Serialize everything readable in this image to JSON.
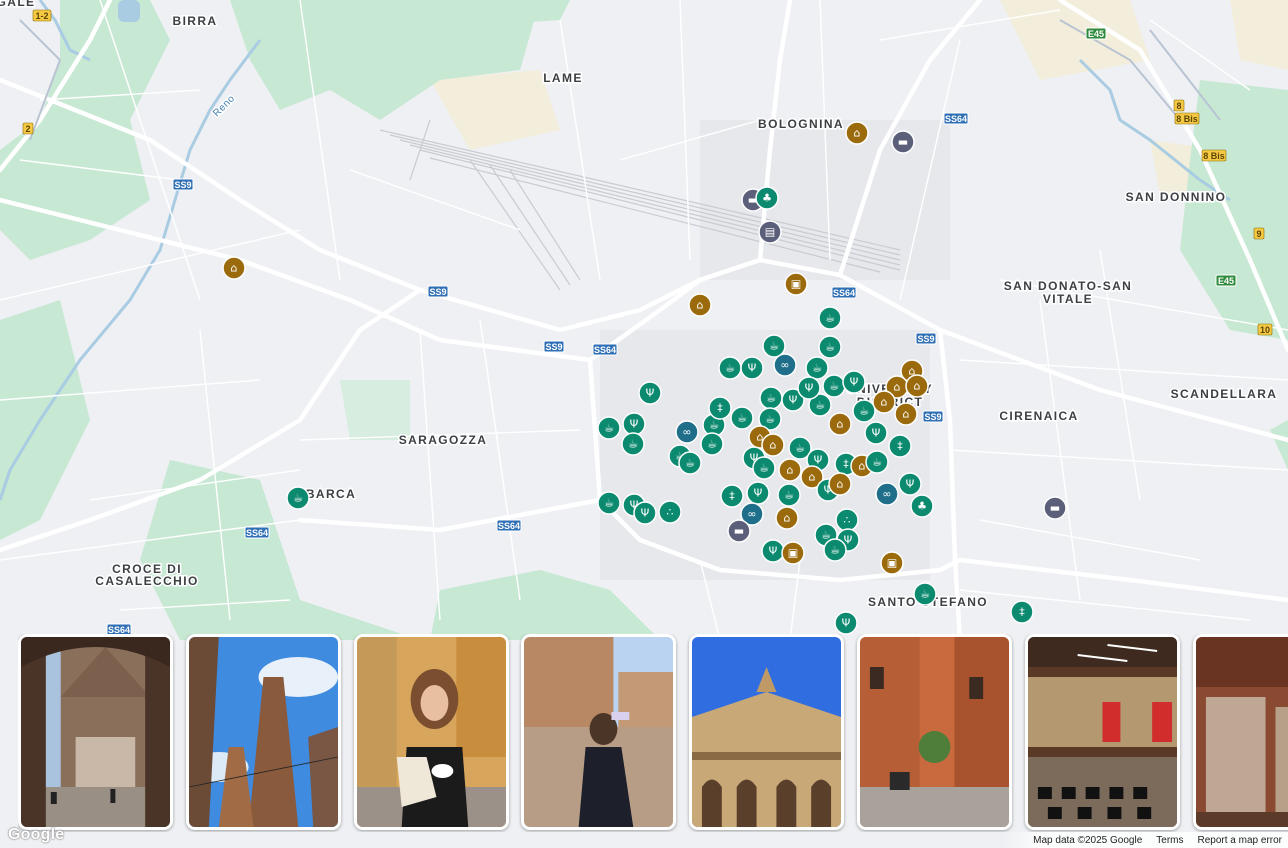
{
  "map": {
    "places": [
      {
        "id": "birra",
        "label": "BIRRA"
      },
      {
        "id": "lame",
        "label": "LAME"
      },
      {
        "id": "bolognina",
        "label": "BOLOGNINA"
      },
      {
        "id": "san-donnino",
        "label": "SAN DONNINO"
      },
      {
        "id": "san-donato-1",
        "label": "SAN DONATO-SAN"
      },
      {
        "id": "san-donato-2",
        "label": "VITALE"
      },
      {
        "id": "scandellara",
        "label": "SCANDELLARA"
      },
      {
        "id": "cirenaica",
        "label": "CIRENAICA"
      },
      {
        "id": "university-1",
        "label": "UNIVERSITY"
      },
      {
        "id": "university-2",
        "label": "DISTRICT"
      },
      {
        "id": "saragozza",
        "label": "SARAGOZZA"
      },
      {
        "id": "barca",
        "label": "BARCA"
      },
      {
        "id": "croce-1",
        "label": "CROCE DI"
      },
      {
        "id": "croce-2",
        "label": "CASALECCHIO"
      },
      {
        "id": "santo-stefano",
        "label": "SANTO STEFANO"
      },
      {
        "id": "gale",
        "label": "GALE"
      },
      {
        "id": "reno",
        "label": "Reno"
      }
    ],
    "road_shields": [
      {
        "label": "SS9"
      },
      {
        "label": "SS9"
      },
      {
        "label": "SS9"
      },
      {
        "label": "SS9"
      },
      {
        "label": "SS9"
      },
      {
        "label": "SS64"
      },
      {
        "label": "SS64"
      },
      {
        "label": "SS64"
      },
      {
        "label": "SS64"
      },
      {
        "label": "SS64"
      },
      {
        "label": "SS64"
      },
      {
        "label": "E45"
      },
      {
        "label": "E45"
      },
      {
        "label": "1-2"
      },
      {
        "label": "2"
      },
      {
        "label": "8"
      },
      {
        "label": "8 Bis"
      },
      {
        "label": "8 Bis"
      },
      {
        "label": "9"
      },
      {
        "label": "10"
      }
    ],
    "poi_categories": {
      "museum": {
        "color": "#9a6a0c",
        "icon": "museum-icon"
      },
      "hotel": {
        "color": "#5c5f7a",
        "icon": "bed-icon"
      },
      "restaurant": {
        "color": "#0c8a6f",
        "icon": "fork-knife-icon"
      },
      "cafe": {
        "color": "#0c8a6f",
        "icon": "coffee-cup-icon"
      },
      "bar": {
        "color": "#0c8a6f",
        "icon": "wine-bottle-icon"
      },
      "shopping": {
        "color": "#9a6a0c",
        "icon": "shopping-bag-icon"
      },
      "sight": {
        "color": "#1f6f8b",
        "icon": "binoculars-icon"
      },
      "park": {
        "color": "#0c8a6f",
        "icon": "tree-icon"
      },
      "transit": {
        "color": "#5c5f7a",
        "icon": "train-icon"
      },
      "grapes": {
        "color": "#0c8a6f",
        "icon": "grapes-icon"
      }
    }
  },
  "photos": [
    {
      "name": "photo-basilica-arches"
    },
    {
      "name": "photo-two-towers"
    },
    {
      "name": "photo-woman-cappuccino"
    },
    {
      "name": "photo-piazza-woman"
    },
    {
      "name": "photo-baroque-building"
    },
    {
      "name": "photo-cafe-street"
    },
    {
      "name": "photo-library-hall"
    },
    {
      "name": "photo-museum-cases"
    }
  ],
  "footer": {
    "map_data": "Map data ©2025 Google",
    "terms": "Terms",
    "report": "Report a map error"
  },
  "logo_text": "Google"
}
